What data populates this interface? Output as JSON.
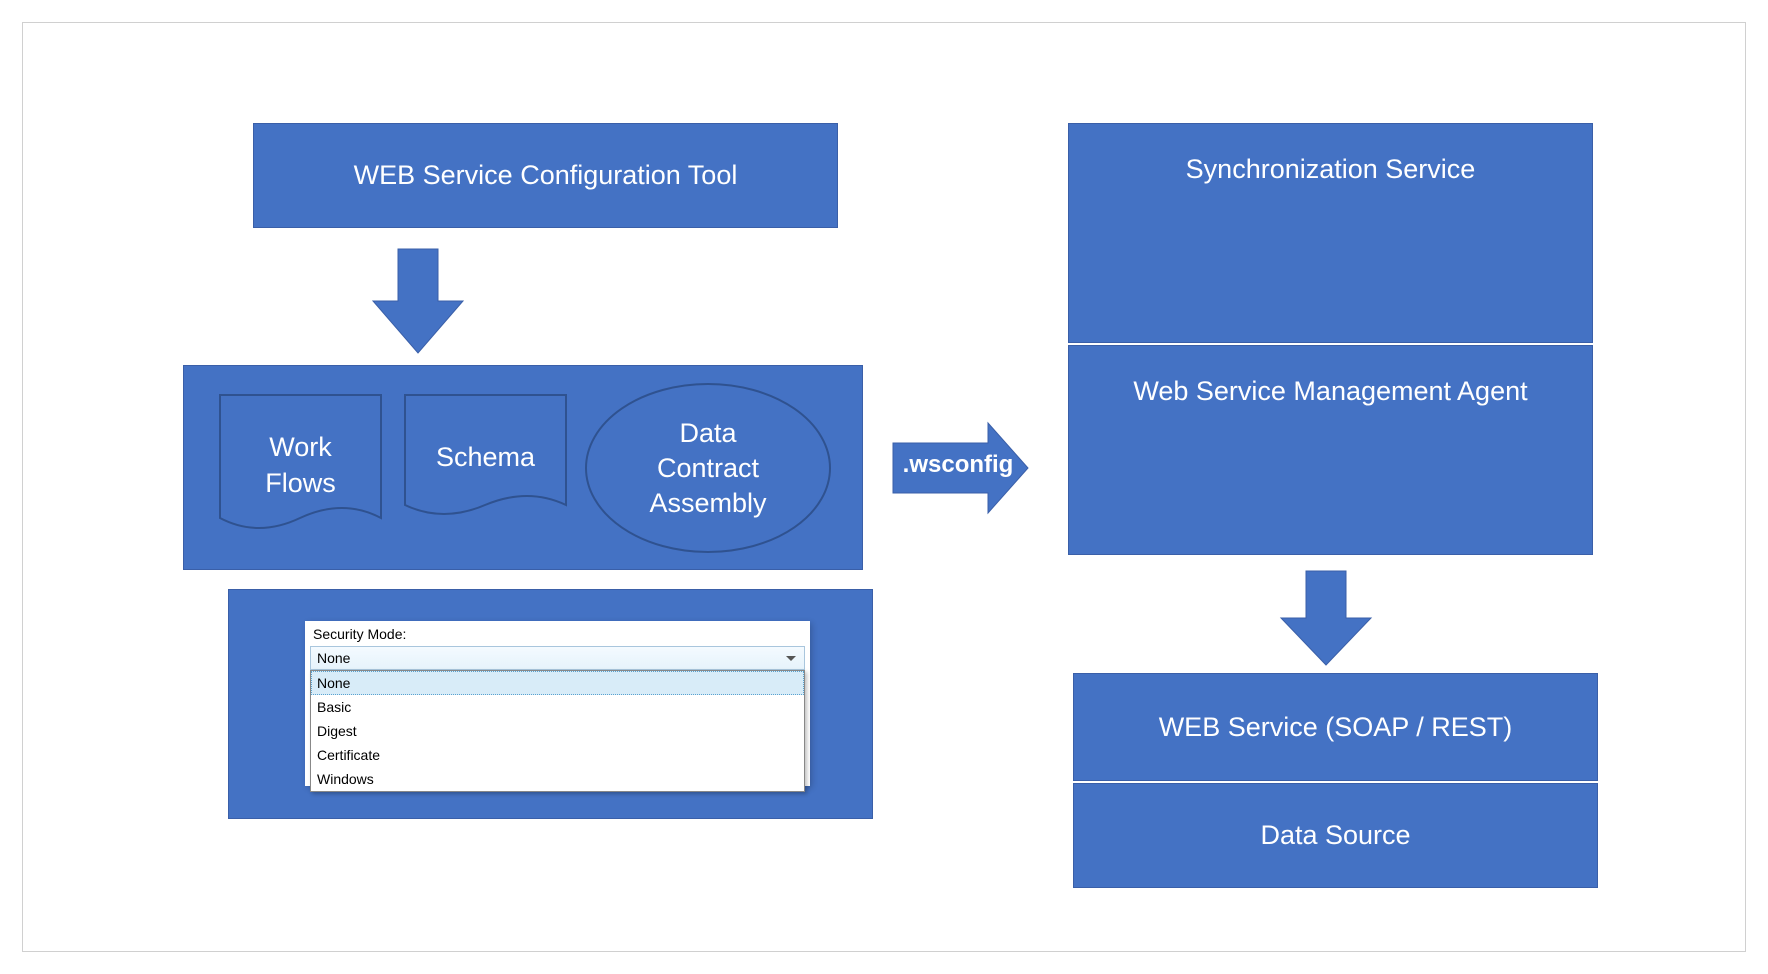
{
  "boxes": {
    "configTool": "WEB Service Configuration Tool",
    "workFlows": "Work\nFlows",
    "schema": "Schema",
    "dataContract": "Data\nContract\nAssembly",
    "wsconfigLabel": ".wsconfig",
    "syncService": "Synchronization Service",
    "managementAgent": "Web Service Management Agent",
    "webService": "WEB Service (SOAP / REST)",
    "dataSource": "Data Source"
  },
  "securityPanel": {
    "label": "Security Mode:",
    "selected": "None",
    "options": [
      "None",
      "Basic",
      "Digest",
      "Certificate",
      "Windows"
    ]
  },
  "colors": {
    "primary": "#4472C4",
    "border": "#3a5fa8"
  }
}
